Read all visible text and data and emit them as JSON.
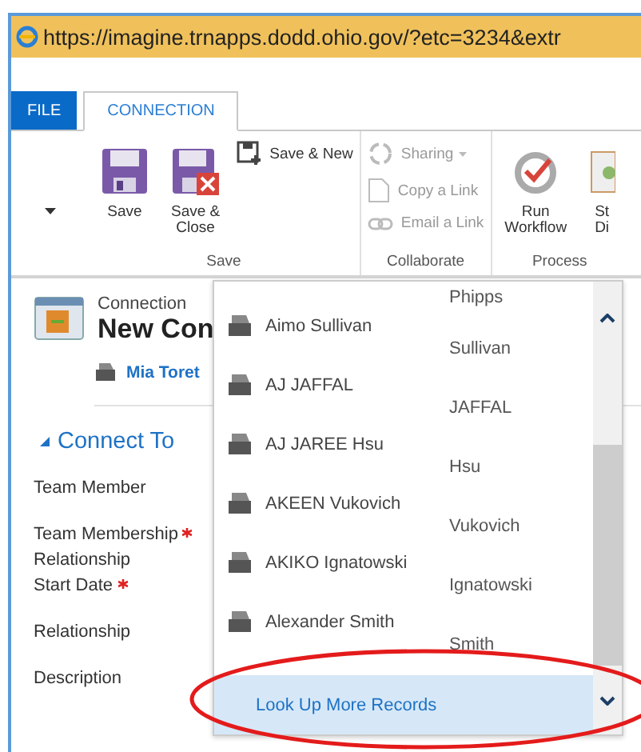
{
  "address_bar": {
    "url": "https://imagine.trnapps.dodd.ohio.gov/?etc=3234&extr"
  },
  "tabs": [
    {
      "label": "FILE",
      "kind": "file",
      "selected": false
    },
    {
      "label": "CONNECTION",
      "kind": "tab",
      "selected": true
    }
  ],
  "ribbon": {
    "groups": [
      {
        "label": "Save",
        "large": [
          {
            "label": "Save"
          },
          {
            "label": "Save &\nClose"
          }
        ],
        "small": [
          {
            "label": "Save & New",
            "disabled": false,
            "dropdown": false
          }
        ]
      },
      {
        "label": "Collaborate",
        "small": [
          {
            "label": "Sharing",
            "disabled": true,
            "dropdown": true
          },
          {
            "label": "Copy a Link",
            "disabled": true,
            "dropdown": false
          },
          {
            "label": "Email a Link",
            "disabled": true,
            "dropdown": false
          }
        ]
      },
      {
        "label": "Process",
        "large": [
          {
            "label": "Run\nWorkflow"
          },
          {
            "label": "St\nDi"
          }
        ]
      }
    ]
  },
  "form": {
    "entity": "Connection",
    "title": "New Con",
    "owner": "Mia Toret",
    "section": "Connect To",
    "fields": [
      {
        "label": "Team Member",
        "required": false
      },
      {
        "label": "Team Membership\nRelationship",
        "required": true
      },
      {
        "label": "Start Date",
        "required": true
      },
      {
        "label": "Relationship",
        "required": false
      },
      {
        "label": "Description",
        "required": false
      }
    ]
  },
  "lookup": {
    "partial_top": "Phipps",
    "items": [
      {
        "name": "Aimo Sullivan",
        "secondary": "Sullivan"
      },
      {
        "name": "AJ JAFFAL",
        "secondary": "JAFFAL"
      },
      {
        "name": "AJ JAREE Hsu",
        "secondary": "Hsu"
      },
      {
        "name": "AKEEN Vukovich",
        "secondary": "Vukovich"
      },
      {
        "name": "AKIKO Ignatowski",
        "secondary": "Ignatowski"
      },
      {
        "name": "Alexander Smith",
        "secondary": "Smith"
      }
    ],
    "more_link": "Look Up More Records"
  }
}
